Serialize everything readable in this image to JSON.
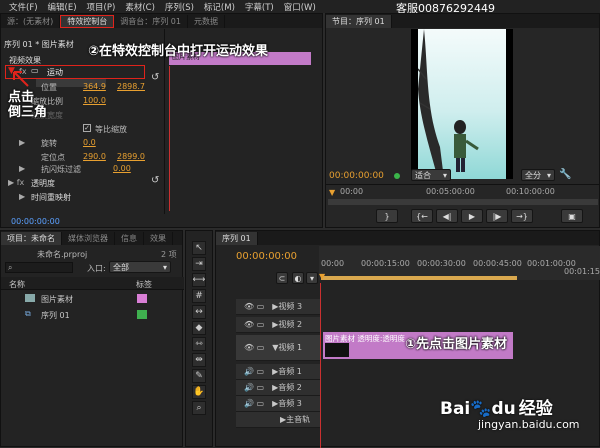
{
  "menu": [
    "文件(F)",
    "编辑(E)",
    "项目(P)",
    "素材(C)",
    "序列(S)",
    "标记(M)",
    "字幕(T)",
    "窗口(W)"
  ],
  "customer_service": "客服00876292449",
  "effect_panel": {
    "tabs": [
      "源：(无素材)",
      "特效控制台",
      "调音台：序列 01",
      "元数据"
    ],
    "header": "序列 01 * 图片素材",
    "clip_label": "图片素材",
    "video_effects": "视频效果",
    "motion": "运动",
    "props": {
      "position": {
        "label": "位置",
        "v1": "364.9",
        "v2": "2898.7"
      },
      "scale": {
        "label": "缩放比例",
        "v1": "100.0"
      },
      "scale_w": {
        "label": "缩放宽度"
      },
      "uniform": "等比缩放",
      "rotation": {
        "label": "旋转",
        "v1": "0.0"
      },
      "anchor": {
        "label": "定位点",
        "v1": "290.0",
        "v2": "2899.0"
      },
      "antiflicker": {
        "label": "抗闪烁过滤",
        "v1": "0.00"
      }
    },
    "opacity": "透明度",
    "time_remap": "时间重映射",
    "timecode": "00:00:00:00"
  },
  "program": {
    "tab": "节目：序列 01",
    "timecode": "00:00:00:00",
    "fit": "适合",
    "full": "全分",
    "ruler": [
      "00:00",
      "00:05:00:00",
      "00:10:00:00"
    ]
  },
  "project": {
    "tabs": [
      "项目：未命名",
      "媒体浏览器",
      "信息",
      "效果"
    ],
    "name": "未命名.prproj",
    "count": "2 项",
    "entry_label": "入口:",
    "entry_value": "全部",
    "col_name": "名称",
    "col_tag": "标签",
    "items": [
      {
        "name": "图片素材",
        "color": "#d97fd6"
      },
      {
        "name": "序列 01",
        "color": "#3fb04f"
      }
    ]
  },
  "timeline": {
    "tab": "序列 01",
    "timecode": "00:00:00:00",
    "ruler": [
      "00:00",
      "00:00:15:00",
      "00:00:30:00",
      "00:00:45:00",
      "00:01:00:00",
      "00:01:15:00"
    ],
    "video_tracks": [
      "视频 3",
      "视频 2",
      "视频 1"
    ],
    "audio_tracks": [
      "音频 1",
      "音频 2",
      "音频 3",
      "主音轨"
    ],
    "clip": "图片素材  透明度:透明度"
  },
  "annotations": {
    "step2": "②在特效控制台中打开运动效果",
    "click": "点击",
    "triangle": "倒三角",
    "step1": "①先点击图片素材"
  },
  "watermark": {
    "brand": "Bai",
    "paw": "du",
    "cn": "经验",
    "url": "jingyan.baidu.com"
  }
}
